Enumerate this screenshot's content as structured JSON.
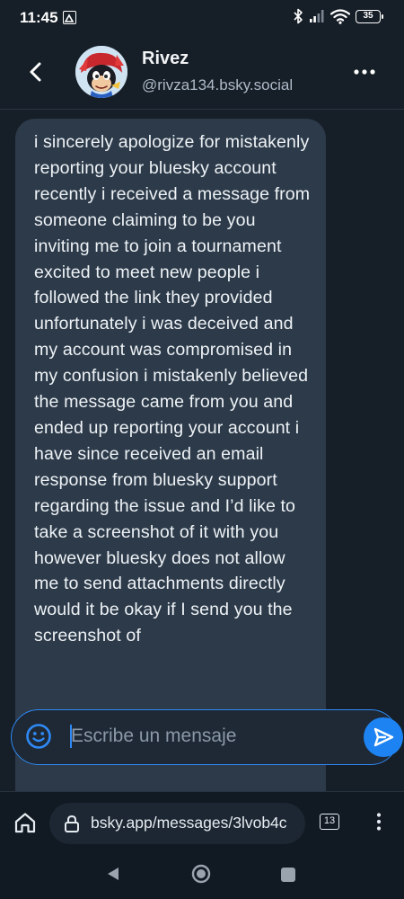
{
  "status_bar": {
    "time": "11:45",
    "battery": "35"
  },
  "header": {
    "name": "Rivez",
    "handle": "@rivza134.bsky.social"
  },
  "message": {
    "text": "i sincerely apologize for mistakenly reporting your bluesky account recently i received a message from someone claiming to be you inviting me to join a tournament excited to meet new people i followed the link they provided unfortunately i was deceived and my account was compromised in my confusion i mistakenly believed the message came from you and ended up reporting your account i have since received an email response from bluesky support regarding the issue and I’d like to take a screenshot of it with you however bluesky does not allow me to send attachments directly would it be okay if I send you the screenshot of"
  },
  "composer": {
    "placeholder": "Escribe un mensaje"
  },
  "browser": {
    "url": "bsky.app/messages/3lvob4c",
    "tab_count": "13"
  },
  "colors": {
    "background": "#161e27",
    "bubble": "#2c3a4a",
    "accent": "#1e83f2"
  },
  "icons": {
    "back": "chevron-left-icon",
    "more": "more-horizontal-icon",
    "emoji": "smiley-icon",
    "send": "send-icon",
    "home": "home-icon",
    "lock": "lock-icon",
    "tabs": "tabs-count-icon",
    "menu": "vertical-dots-icon"
  }
}
